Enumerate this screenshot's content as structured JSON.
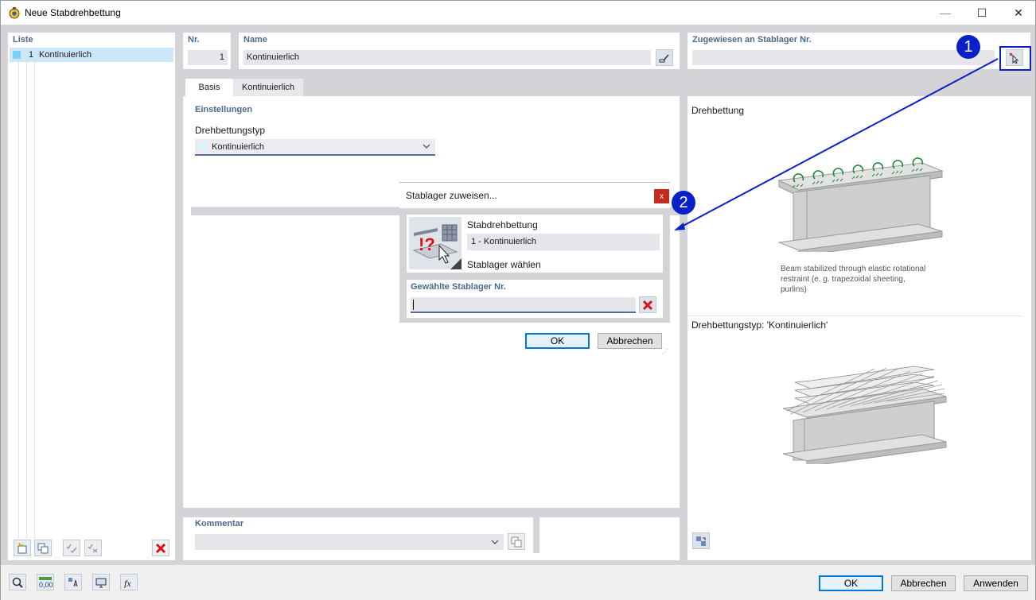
{
  "window": {
    "title": "Neue Stabdrehbettung",
    "minimize": "—",
    "maximize": "☐",
    "close": "✕"
  },
  "list": {
    "header": "Liste",
    "items": [
      {
        "num": "1",
        "label": "Kontinuierlich",
        "color": "#7fd0f5"
      }
    ]
  },
  "header": {
    "nr_label": "Nr.",
    "nr_value": "1",
    "name_label": "Name",
    "name_value": "Kontinuierlich",
    "assigned_label": "Zugewiesen an Stablager Nr.",
    "assigned_value": ""
  },
  "tabs": [
    {
      "label": "Basis",
      "active": true
    },
    {
      "label": "Kontinuierlich",
      "active": false
    }
  ],
  "settings": {
    "header": "Einstellungen",
    "type_label": "Drehbettungstyp",
    "type_value": "Kontinuierlich",
    "type_color": "#d8f4fb"
  },
  "comment": {
    "label": "Kommentar",
    "value": ""
  },
  "preview": {
    "header1": "Drehbettung",
    "caption": "Beam stabilized through elastic rotational restraint (e. g. trapezoidal sheeting, purlins)",
    "header2": "Drehbettungstyp: 'Kontinuierlich'"
  },
  "dialog": {
    "title": "Stablager zuweisen...",
    "close": "x",
    "object_label": "Stabdrehbettung",
    "object_value": "1 - Kontinuierlich",
    "select_label": "Stablager wählen",
    "chosen_label": "Gewählte Stablager Nr.",
    "chosen_value": "",
    "ok": "OK",
    "cancel": "Abbrechen"
  },
  "markers": [
    "1",
    "2"
  ],
  "footer": {
    "ok": "OK",
    "cancel": "Abbrechen",
    "apply": "Anwenden"
  },
  "colors": {
    "accent": "#0a20c8",
    "label": "#4a6a8a",
    "dialog_close": "#c42b1c",
    "delete": "#e01010"
  }
}
